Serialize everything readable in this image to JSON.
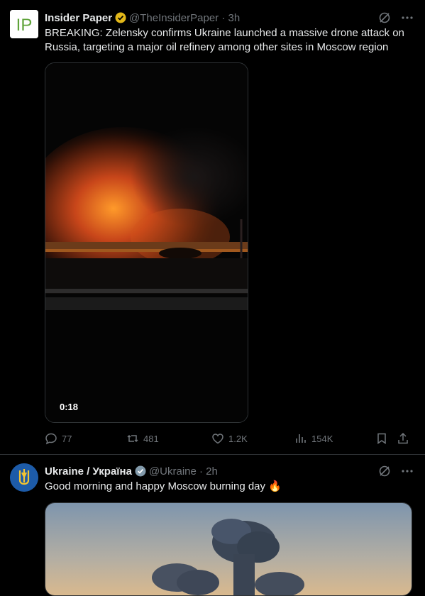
{
  "tweet1": {
    "name": "Insider Paper",
    "handle": "@TheInsiderPaper · 3h",
    "avatar_text": "IP",
    "text": "BREAKING: Zelensky confirms Ukraine launched a massive drone attack on Russia, targeting a major oil refinery among other sites in Moscow region",
    "video_duration": "0:18",
    "replies": "77",
    "reposts": "481",
    "likes": "1.2K",
    "views": "154K"
  },
  "tweet2": {
    "name": "Ukraine / Україна",
    "handle": "@Ukraine · 2h",
    "text": "Good morning and happy Moscow burning day",
    "emoji": "🔥"
  },
  "colors": {
    "background": "#000000",
    "text": "#e7e9ea",
    "muted": "#71767b",
    "gold_badge": "#e2b719",
    "blue_badge": "#829aab",
    "divider": "#2f3336"
  },
  "icons": [
    "grok-icon",
    "more-icon",
    "reply-icon",
    "repost-icon",
    "like-icon",
    "views-icon",
    "bookmark-icon",
    "share-icon",
    "verified-badge-icon"
  ]
}
